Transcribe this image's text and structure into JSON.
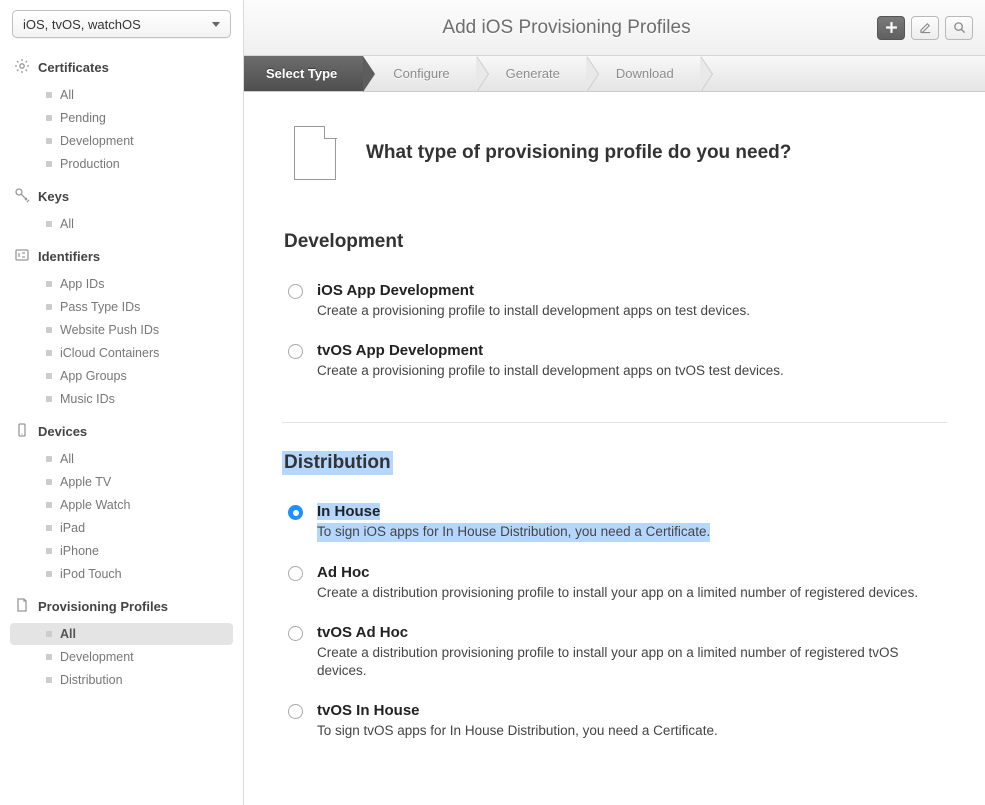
{
  "platform_selector": "iOS, tvOS, watchOS",
  "sidebar": [
    {
      "title": "Certificates",
      "icon": "gear",
      "items": [
        "All",
        "Pending",
        "Development",
        "Production"
      ],
      "active_index": -1
    },
    {
      "title": "Keys",
      "icon": "key",
      "items": [
        "All"
      ],
      "active_index": -1
    },
    {
      "title": "Identifiers",
      "icon": "id",
      "items": [
        "App IDs",
        "Pass Type IDs",
        "Website Push IDs",
        "iCloud Containers",
        "App Groups",
        "Music IDs"
      ],
      "active_index": -1
    },
    {
      "title": "Devices",
      "icon": "device",
      "items": [
        "All",
        "Apple TV",
        "Apple Watch",
        "iPad",
        "iPhone",
        "iPod Touch"
      ],
      "active_index": -1
    },
    {
      "title": "Provisioning Profiles",
      "icon": "document",
      "items": [
        "All",
        "Development",
        "Distribution"
      ],
      "active_index": 0
    }
  ],
  "page_title": "Add iOS Provisioning Profiles",
  "steps": [
    "Select Type",
    "Configure",
    "Generate",
    "Download"
  ],
  "active_step": 0,
  "hero_question": "What type of provisioning profile do you need?",
  "groups": [
    {
      "heading": "Development",
      "highlight": false,
      "options": [
        {
          "title": "iOS App Development",
          "desc": "Create a provisioning profile to install development apps on test devices.",
          "checked": false,
          "highlight": false
        },
        {
          "title": "tvOS App Development",
          "desc": "Create a provisioning profile to install development apps on tvOS test devices.",
          "checked": false,
          "highlight": false
        }
      ]
    },
    {
      "heading": "Distribution",
      "highlight": true,
      "options": [
        {
          "title": "In House",
          "desc": "To sign iOS apps for In House Distribution, you need a Certificate.",
          "checked": true,
          "highlight": true
        },
        {
          "title": "Ad Hoc",
          "desc": "Create a distribution provisioning profile to install your app on a limited number of registered devices.",
          "checked": false,
          "highlight": false
        },
        {
          "title": "tvOS Ad Hoc",
          "desc": "Create a distribution provisioning profile to install your app on a limited number of registered tvOS devices.",
          "checked": false,
          "highlight": false
        },
        {
          "title": "tvOS In House",
          "desc": "To sign tvOS apps for In House Distribution, you need a Certificate.",
          "checked": false,
          "highlight": false
        }
      ]
    }
  ]
}
